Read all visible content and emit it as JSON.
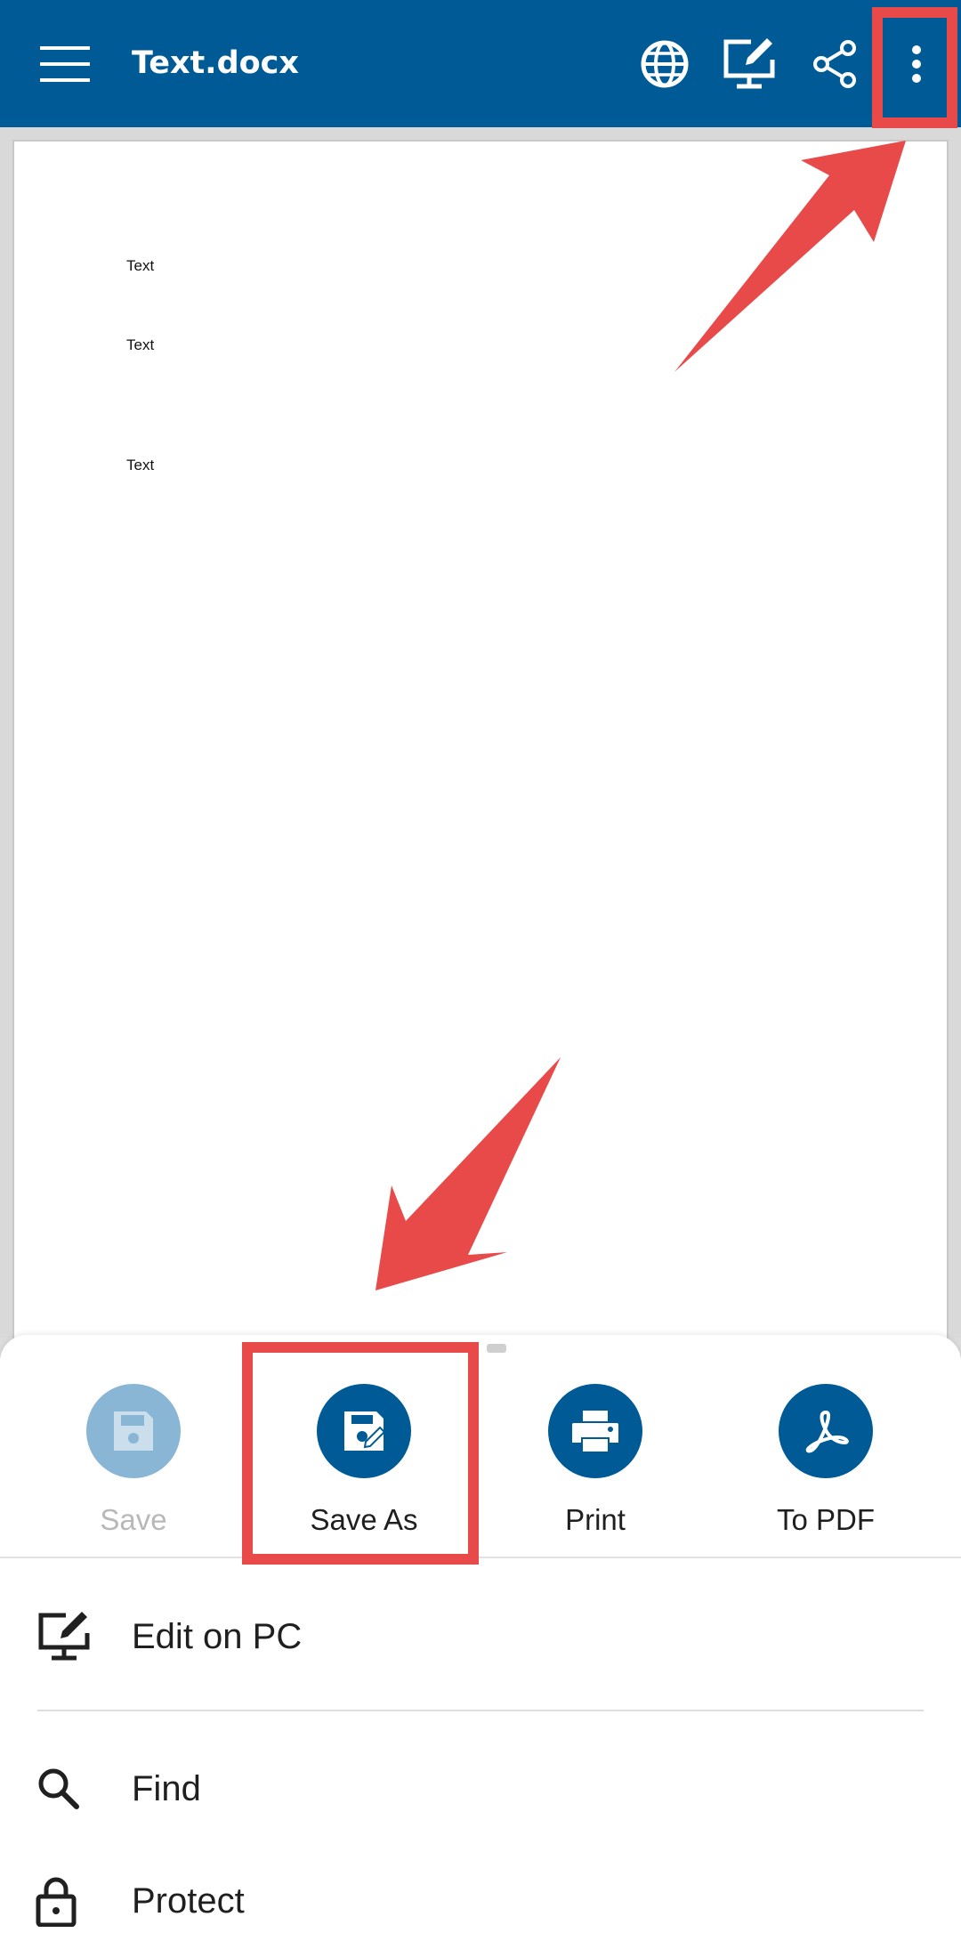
{
  "app_bar": {
    "title": "Text.docx",
    "background": "#005a96",
    "icons": [
      "menu-icon",
      "globe-icon",
      "edit-on-pc-icon",
      "share-icon",
      "more-vertical-icon"
    ]
  },
  "document": {
    "lines": [
      "Text",
      "Text",
      "Text"
    ]
  },
  "sheet": {
    "actions": [
      {
        "label": "Save",
        "icon": "save-icon",
        "enabled": false
      },
      {
        "label": "Save As",
        "icon": "save-as-icon",
        "enabled": true
      },
      {
        "label": "Print",
        "icon": "print-icon",
        "enabled": true
      },
      {
        "label": "To PDF",
        "icon": "pdf-icon",
        "enabled": true
      }
    ],
    "items": [
      {
        "label": "Edit on PC",
        "icon": "edit-on-pc-icon"
      },
      {
        "label": "Find",
        "icon": "search-icon"
      },
      {
        "label": "Protect",
        "icon": "lock-icon"
      }
    ]
  },
  "annotations": {
    "highlight_color": "#e84a4a"
  }
}
